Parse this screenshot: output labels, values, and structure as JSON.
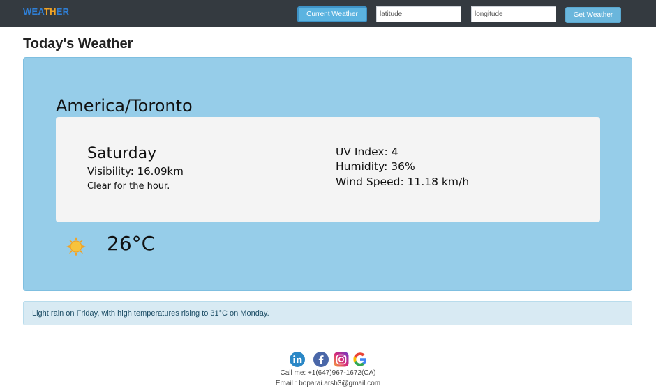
{
  "navbar": {
    "brand": {
      "part1": "WEA",
      "part2": "TH",
      "part3": "ER"
    },
    "current_weather_label": "Current Weather",
    "latitude_placeholder": "latitude",
    "longitude_placeholder": "longitude",
    "get_weather_label": "Get Weather"
  },
  "page": {
    "title": "Today's Weather"
  },
  "weather": {
    "location": "America/Toronto",
    "day": "Saturday",
    "visibility": "Visibility: 16.09km",
    "summary": "Clear for the hour.",
    "uv_index": "UV Index: 4",
    "humidity": "Humidity: 36%",
    "wind_speed": "Wind Speed: 11.18 km/h",
    "temperature": "26°C",
    "icon": "sun-icon"
  },
  "forecast": {
    "text": "Light rain on Friday, with high temperatures rising to 31°C on Monday."
  },
  "footer": {
    "phone": "Call me: +1(647)967-1672(CA)",
    "email": "Email : boparai.arsh3@gmail.com",
    "social_icons": [
      "linkedin-icon",
      "facebook-icon",
      "instagram-icon",
      "google-icon"
    ]
  },
  "colors": {
    "navbar": "#343a40",
    "card": "#96cde9",
    "button": "#6ab6dc",
    "forecast_bg": "#d8eaf3"
  }
}
